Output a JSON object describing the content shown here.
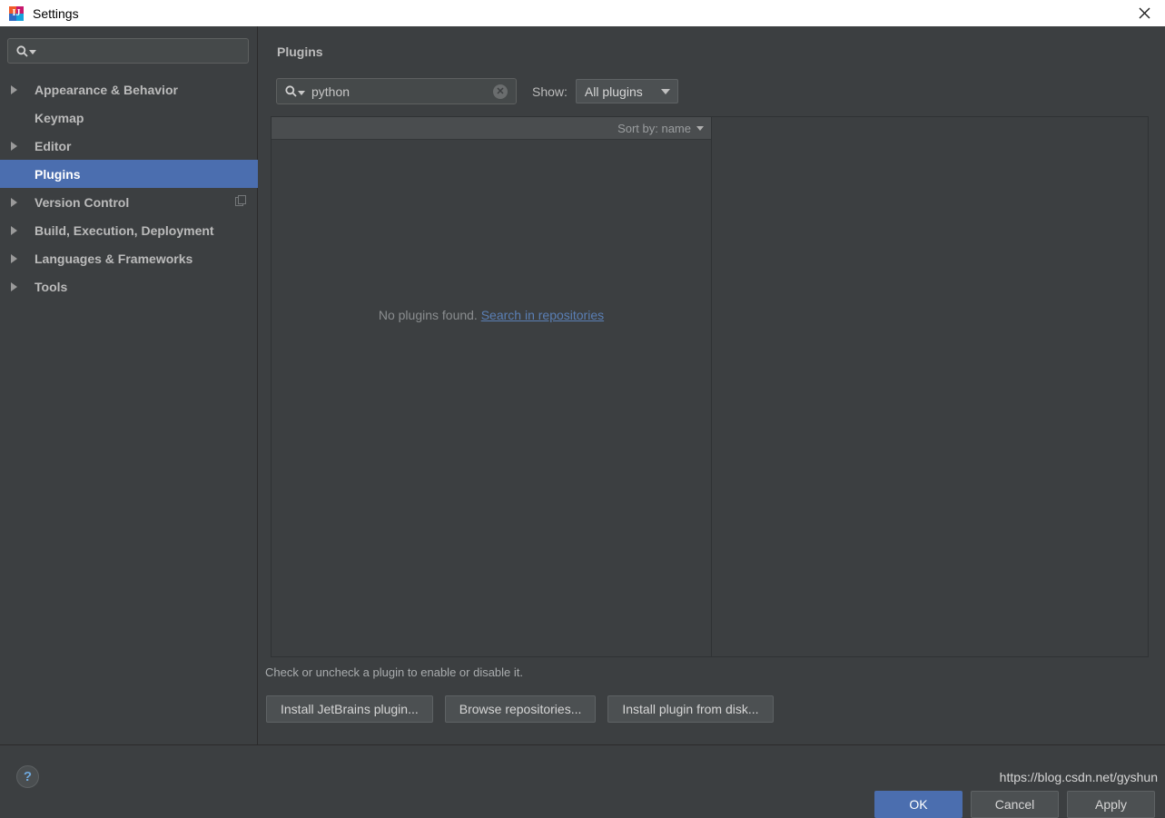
{
  "window": {
    "title": "Settings",
    "app_icon": "jetbrains-intellij-icon",
    "close_label": "✕"
  },
  "sidebar": {
    "search": {
      "value": "",
      "placeholder": "",
      "icon": "search-icon"
    },
    "items": [
      {
        "label": "Appearance & Behavior",
        "expandable": true,
        "selected": false
      },
      {
        "label": "Keymap",
        "expandable": false,
        "selected": false
      },
      {
        "label": "Editor",
        "expandable": true,
        "selected": false
      },
      {
        "label": "Plugins",
        "expandable": false,
        "selected": true
      },
      {
        "label": "Version Control",
        "expandable": true,
        "selected": false,
        "badge_icon": "copy-icon"
      },
      {
        "label": "Build, Execution, Deployment",
        "expandable": true,
        "selected": false
      },
      {
        "label": "Languages & Frameworks",
        "expandable": true,
        "selected": false
      },
      {
        "label": "Tools",
        "expandable": true,
        "selected": false
      }
    ]
  },
  "content": {
    "title": "Plugins",
    "search": {
      "value": "python",
      "placeholder": "",
      "icon": "search-icon",
      "clear_icon": "clear-circle-icon",
      "clear_glyph": "✕"
    },
    "show_label": "Show:",
    "show_value": "All plugins",
    "sort_label": "Sort by: name",
    "empty_text": "No plugins found.",
    "empty_link": "Search in repositories",
    "hint": "Check or uncheck a plugin to enable or disable it.",
    "buttons": [
      "Install JetBrains plugin...",
      "Browse repositories...",
      "Install plugin from disk..."
    ]
  },
  "bottom": {
    "help_glyph": "?",
    "watermark": "https://blog.csdn.net/gyshun",
    "ok": "OK",
    "cancel": "Cancel",
    "apply": "Apply"
  },
  "colors": {
    "background": "#3c3f41",
    "selection": "#4b6eaf",
    "titlebar": "#ffffff",
    "link": "#5a7fb5",
    "text": "#bbbbbb"
  }
}
